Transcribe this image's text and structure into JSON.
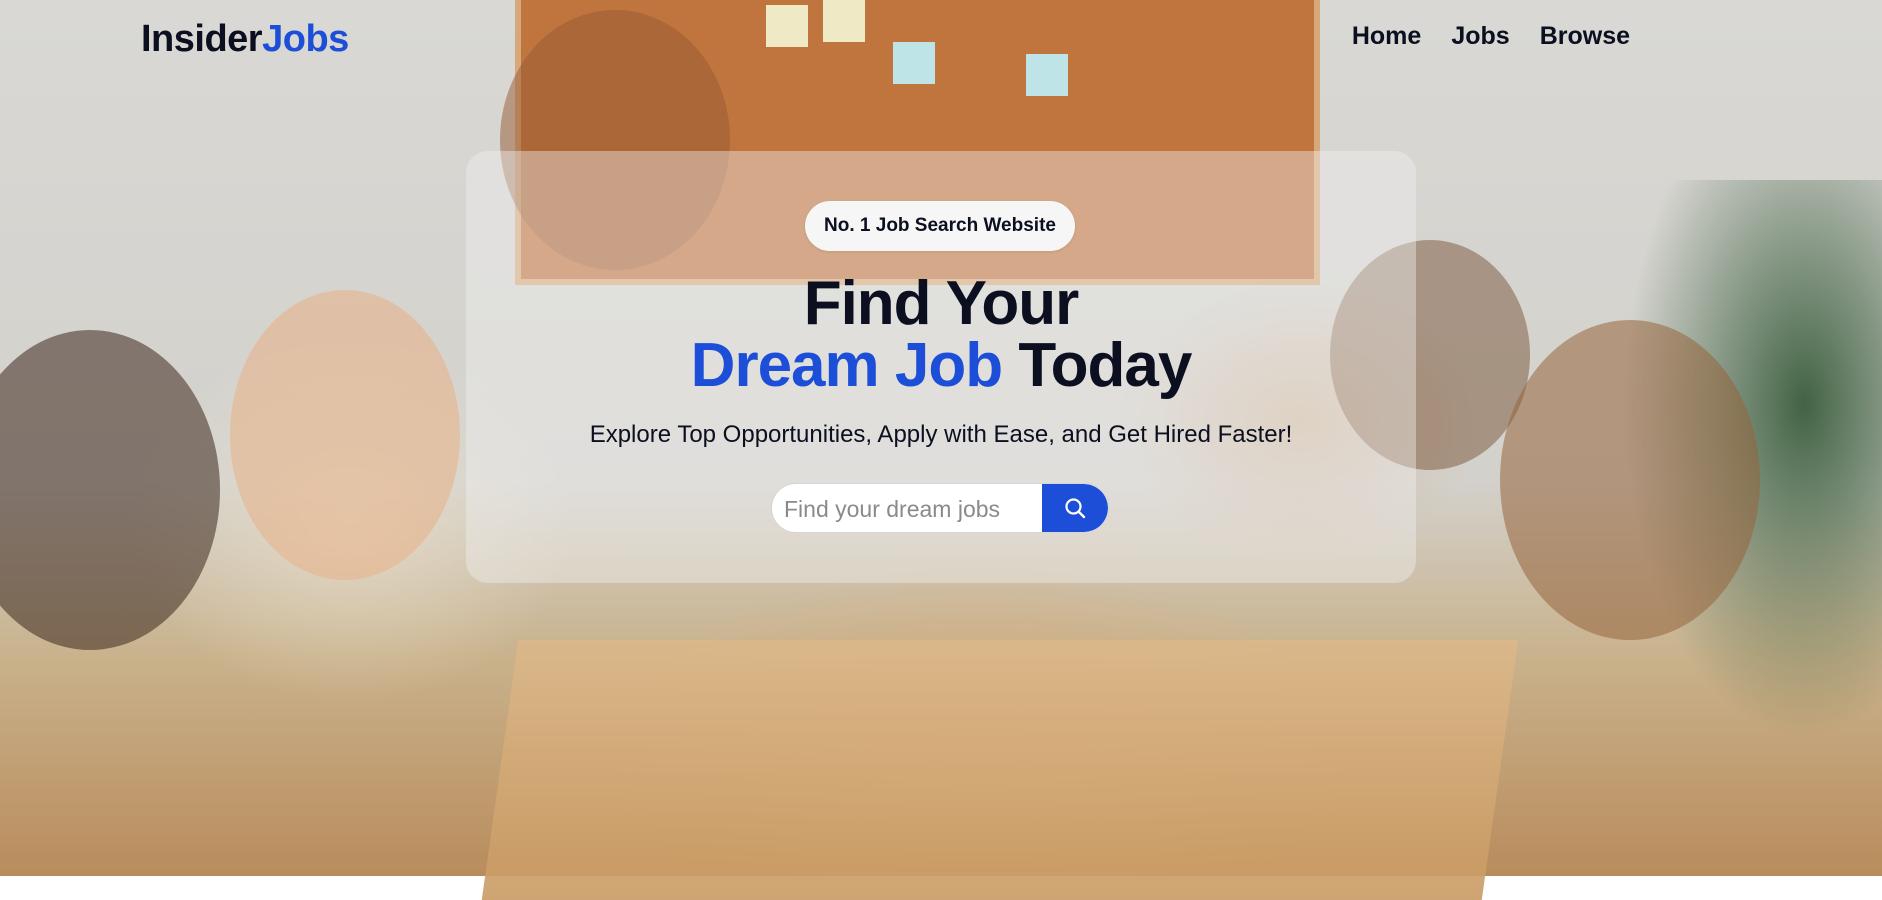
{
  "brand": {
    "part1": "Insider",
    "part2": "Jobs",
    "accent": "#1d4ed8"
  },
  "nav": {
    "home": "Home",
    "jobs": "Jobs",
    "browse": "Browse"
  },
  "hero": {
    "badge": "No. 1 Job Search Website",
    "headline_line1": "Find Your",
    "headline_line2_blue": "Dream Job",
    "headline_line2_rest": " Today",
    "subtitle": "Explore Top Opportunities, Apply with Ease, and Get Hired Faster!"
  },
  "search": {
    "placeholder": "Find your dream jobs",
    "button_icon": "search-icon"
  },
  "colors": {
    "text": "#0b0f1f",
    "accent": "#1d4ed8"
  }
}
